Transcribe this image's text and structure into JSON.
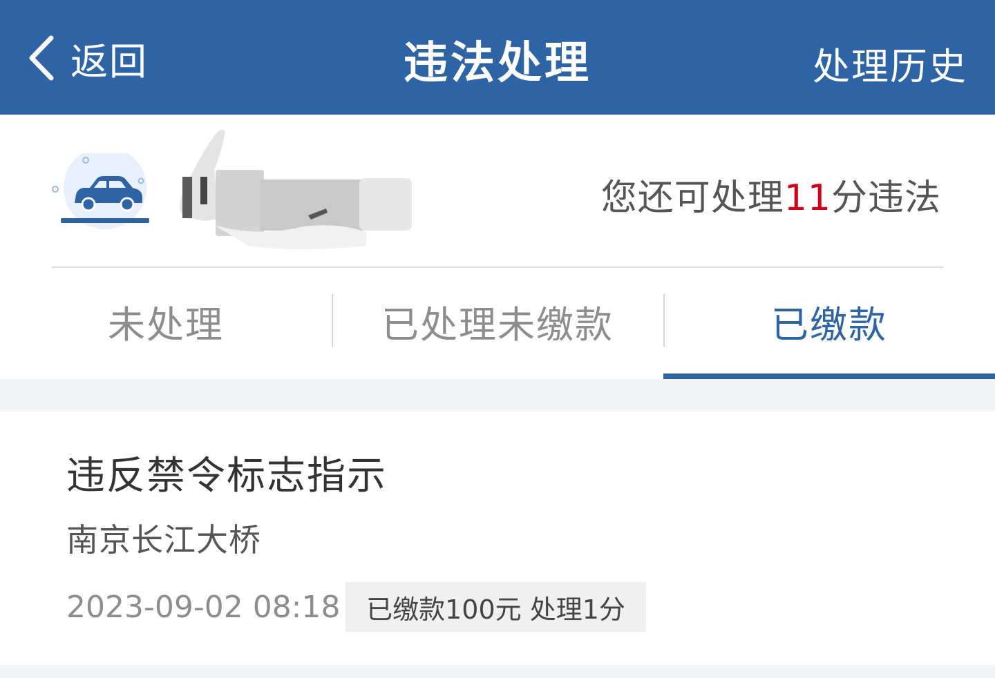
{
  "header": {
    "back_label": "返回",
    "title": "违法处理",
    "history_label": "处理历史",
    "background_color": "#2e64a6"
  },
  "vehicle": {
    "icon": "car-icon",
    "plate_number": "",
    "points_prefix": "您还可处理",
    "points_value": "11",
    "points_suffix": "分违法",
    "points_color": "#d0021b"
  },
  "tabs": [
    {
      "label": "未处理",
      "active": false
    },
    {
      "label": "已处理未缴款",
      "active": false
    },
    {
      "label": "已缴款",
      "active": true
    }
  ],
  "records": [
    {
      "title": "违反禁令标志指示",
      "location": "南京长江大桥",
      "time": "2023-09-02 08:18",
      "status": "已缴款100元 处理1分"
    }
  ]
}
